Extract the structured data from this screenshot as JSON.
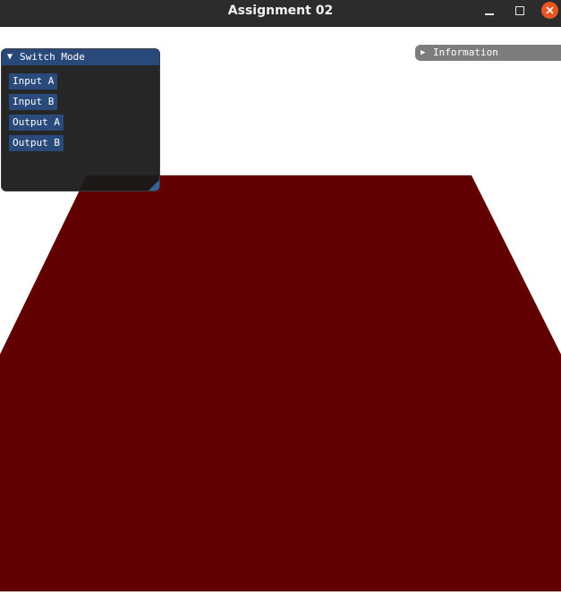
{
  "window": {
    "title": "Assignment 02",
    "controls": {
      "minimize": "minimize",
      "maximize": "maximize",
      "close": "close"
    }
  },
  "scene": {
    "plane_color": "#600000",
    "background_color": "#ffffff"
  },
  "switch_mode_panel": {
    "title": "Switch Mode",
    "arrow_icon": "triangle-down-icon",
    "buttons": [
      "Input A",
      "Input B",
      "Output A",
      "Output B"
    ]
  },
  "information_panel": {
    "title": "Information",
    "arrow_icon": "triangle-right-icon"
  }
}
